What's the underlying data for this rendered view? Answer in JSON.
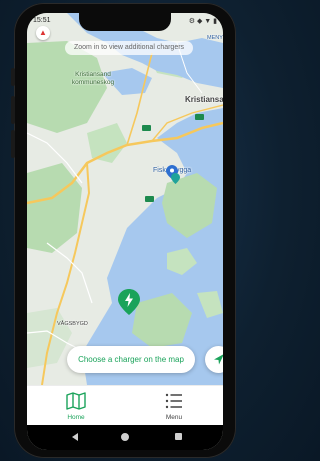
{
  "status_bar": {
    "time": "15:51",
    "icons": "⚙ ◆ ▼ ▮"
  },
  "map": {
    "zoom_hint": "Zoom in to view additional chargers",
    "compass_icon": "compass-icon",
    "labels": {
      "kristiansand_kommuneskog": "Kristiansand kommuneskog",
      "kristiansand": "Kristiansa",
      "fiskebrygga": "Fiskebrygga",
      "vagsbygd": "VÅGSBYGD",
      "meny": "MENY"
    },
    "charger_icon": "ev-charger-pin-icon",
    "poi_icon": "location-pin-icon"
  },
  "actions": {
    "choose_charger": "Choose a charger on the map",
    "locate_icon": "navigation-arrow-icon"
  },
  "bottom_nav": {
    "items": [
      {
        "label": "Home",
        "icon": "map-icon",
        "active": true
      },
      {
        "label": "Menu",
        "icon": "list-icon",
        "active": false
      }
    ]
  },
  "colors": {
    "accent": "#1aa35a",
    "water": "#a6c8ee",
    "land": "#e7ebe4",
    "forest": "#b7dbb0",
    "road": "#f6c85c"
  }
}
